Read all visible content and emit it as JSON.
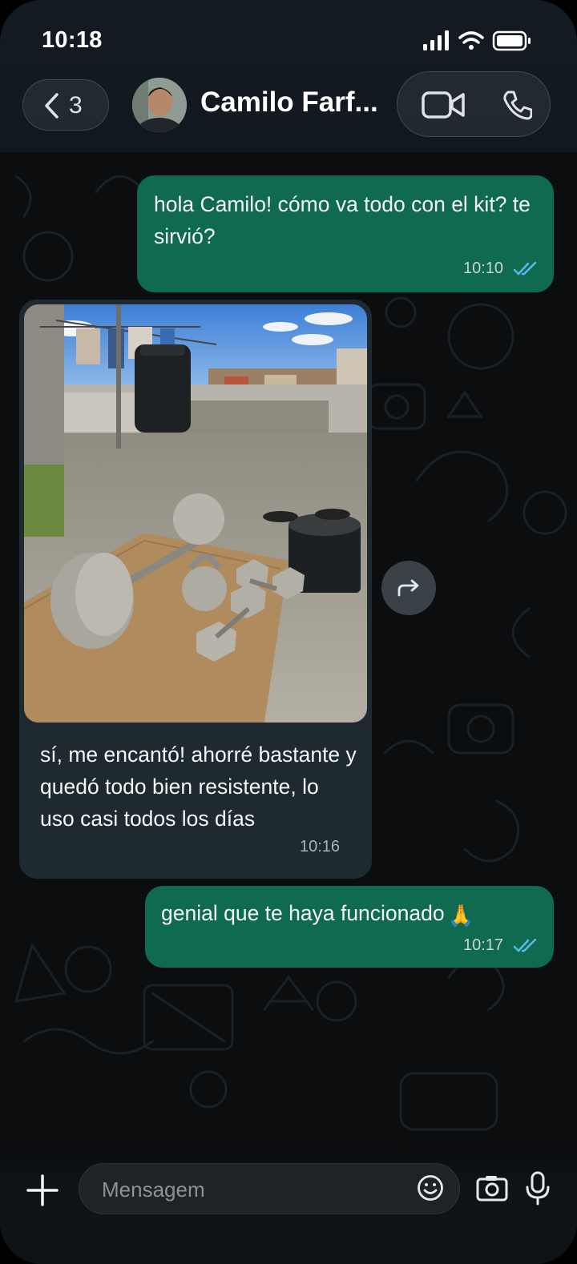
{
  "status_bar": {
    "time": "10:18"
  },
  "header": {
    "back_count": "3",
    "contact_name": "Camilo Farf..."
  },
  "messages": [
    {
      "direction": "outgoing",
      "text": "hola Camilo! cómo va todo con el kit? te sirvió?",
      "time": "10:10",
      "status": "read"
    },
    {
      "direction": "incoming",
      "has_image": true,
      "image_description": "photo",
      "text": "sí, me encantó! ahorré bastante y quedó todo bien resistente, lo uso casi todos los días",
      "time": "10:16"
    },
    {
      "direction": "outgoing",
      "text": "genial que te haya funcionado",
      "emoji": "🙏",
      "time": "10:17",
      "status": "read"
    }
  ],
  "composer": {
    "placeholder": "Mensagem"
  },
  "icons": {
    "back": "chevron-left-icon",
    "video": "video-call-icon",
    "voice": "phone-icon",
    "forward": "forward-icon",
    "attach": "plus-icon",
    "sticker": "sticker-icon",
    "camera": "camera-icon",
    "mic": "microphone-icon"
  },
  "colors": {
    "outgoing_bubble": "#0f6a50",
    "incoming_bubble": "#1e2a30",
    "read_ticks": "#53bdeb",
    "background": "#0b0d0f"
  }
}
